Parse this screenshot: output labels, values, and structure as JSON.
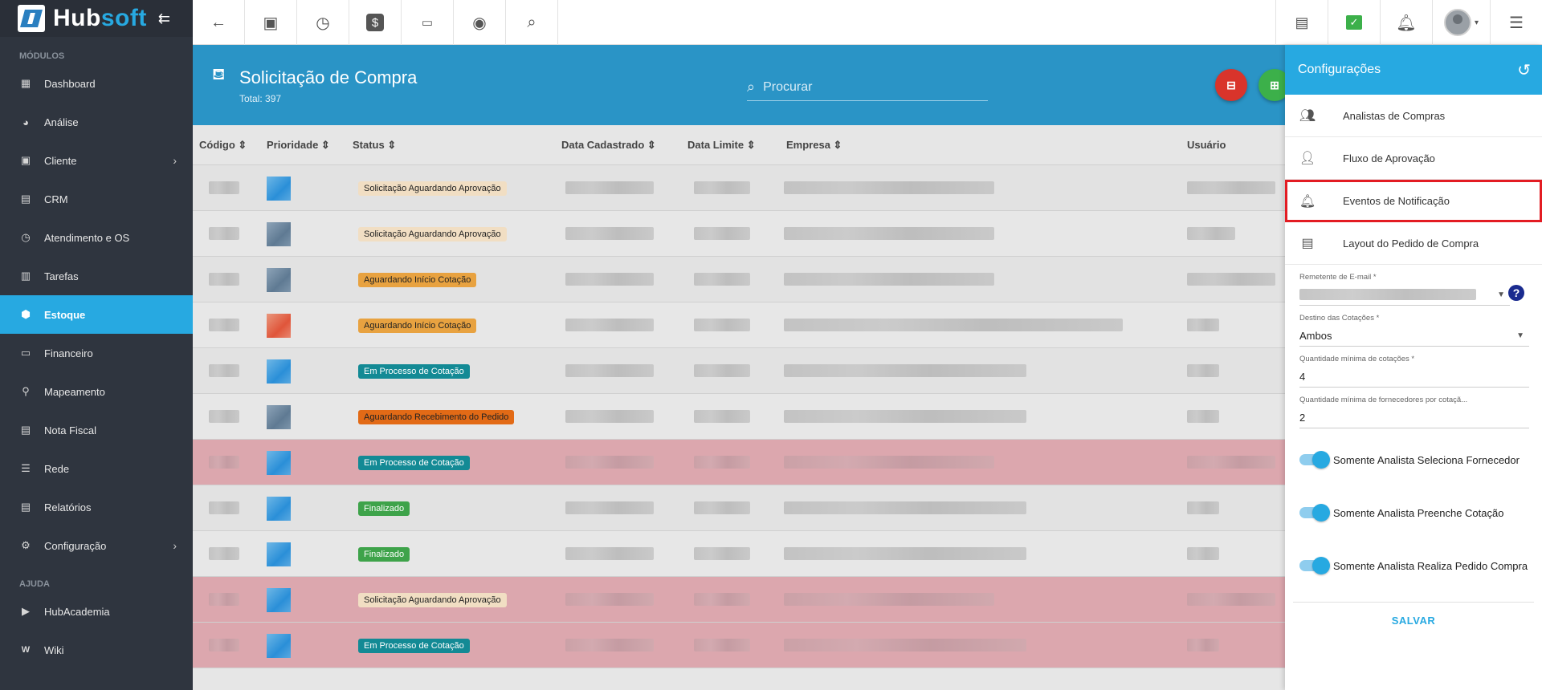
{
  "brand": {
    "hub": "Hub",
    "soft": "soft"
  },
  "sidebar": {
    "section_modulos": "MÓDULOS",
    "section_ajuda": "AJUDA",
    "items": [
      {
        "label": "Dashboard",
        "icon": "dashboard-icon"
      },
      {
        "label": "Análise",
        "icon": "pie-chart-icon"
      },
      {
        "label": "Cliente",
        "icon": "contact-card-icon"
      },
      {
        "label": "CRM",
        "icon": "crm-board-icon"
      },
      {
        "label": "Atendimento e OS",
        "icon": "calendar-clock-icon"
      },
      {
        "label": "Tarefas",
        "icon": "calendar-icon"
      },
      {
        "label": "Estoque",
        "icon": "cube-icon"
      },
      {
        "label": "Financeiro",
        "icon": "money-icon"
      },
      {
        "label": "Mapeamento",
        "icon": "map-pin-icon"
      },
      {
        "label": "Nota Fiscal",
        "icon": "document-icon"
      },
      {
        "label": "Rede",
        "icon": "server-icon"
      },
      {
        "label": "Relatórios",
        "icon": "report-icon"
      },
      {
        "label": "Configuração",
        "icon": "gear-icon"
      },
      {
        "label": "HubAcademia",
        "icon": "academy-icon"
      },
      {
        "label": "Wiki",
        "icon": "wiki-icon"
      }
    ]
  },
  "page": {
    "title": "Solicitação de Compra",
    "total": "Total: 397",
    "search_placeholder": "Procurar"
  },
  "table": {
    "headers": [
      "Código",
      "Prioridade",
      "Status",
      "Data Cadastrado",
      "Data Limite",
      "Empresa",
      "Usuário"
    ],
    "rows": [
      {
        "status": "Solicitação Aguardando Aprovação",
        "priority_color": "blue",
        "highlighted": false
      },
      {
        "status": "Solicitação Aguardando Aprovação",
        "priority_color": "slate",
        "highlighted": false
      },
      {
        "status": "Aguardando Início Cotação",
        "priority_color": "slate",
        "highlighted": false
      },
      {
        "status": "Aguardando Início Cotação",
        "priority_color": "red",
        "highlighted": false
      },
      {
        "status": "Em Processo de Cotação",
        "priority_color": "blue",
        "highlighted": false
      },
      {
        "status": "Aguardando Recebimento do Pedido",
        "priority_color": "slate",
        "highlighted": false
      },
      {
        "status": "Em Processo de Cotação",
        "priority_color": "blue",
        "highlighted": true
      },
      {
        "status": "Finalizado",
        "priority_color": "blue",
        "highlighted": false
      },
      {
        "status": "Finalizado",
        "priority_color": "blue",
        "highlighted": false
      },
      {
        "status": "Solicitação Aguardando Aprovação",
        "priority_color": "blue",
        "highlighted": true
      },
      {
        "status": "Em Processo de Cotação",
        "priority_color": "blue",
        "highlighted": true
      }
    ]
  },
  "panel": {
    "title": "Configurações",
    "menu": [
      {
        "label": "Analistas de Compras"
      },
      {
        "label": "Fluxo de Aprovação"
      },
      {
        "label": "Eventos de Notificação"
      },
      {
        "label": "Layout do Pedido de Compra"
      }
    ],
    "fields": {
      "remetente_label": "Remetente de E-mail *",
      "destino_label": "Destino das Cotações *",
      "destino_value": "Ambos",
      "qtd_cot_label": "Quantidade mínima de cotações *",
      "qtd_cot_value": "4",
      "qtd_forn_label": "Quantidade mínima de fornecedores por cotaçã...",
      "qtd_forn_value": "2"
    },
    "toggles": [
      {
        "label": "Somente Analista Seleciona Fornecedor",
        "on": true
      },
      {
        "label": "Somente Analista Preenche Cotação",
        "on": true
      },
      {
        "label": "Somente Analista Realiza Pedido Compra",
        "on": true
      }
    ],
    "save_label": "SALVAR"
  },
  "colors": {
    "accent": "#27a9e1",
    "sidebar_bg": "#2f353f",
    "header_bg": "#2a94c6",
    "highlight_row": "#dca7ae",
    "outline_red": "#e31c23"
  }
}
